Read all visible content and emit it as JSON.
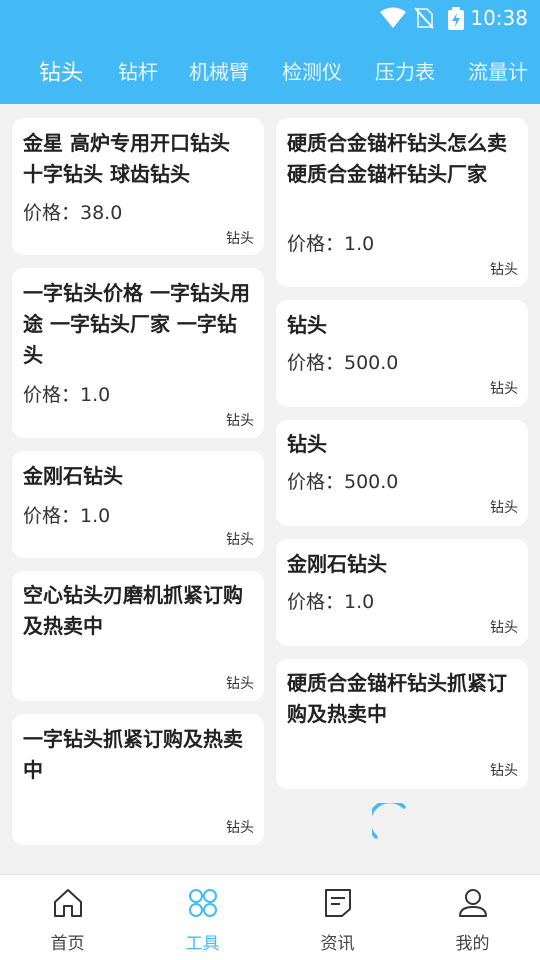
{
  "status_bar": {
    "time": "10:38",
    "icons": [
      "wifi-icon",
      "no-sim-icon",
      "battery-charging-icon"
    ]
  },
  "tabs": [
    {
      "label": "钻头",
      "active": true
    },
    {
      "label": "钻杆",
      "active": false
    },
    {
      "label": "机械臂",
      "active": false
    },
    {
      "label": "检测仪",
      "active": false
    },
    {
      "label": "压力表",
      "active": false
    },
    {
      "label": "流量计",
      "active": false
    }
  ],
  "left_column": [
    {
      "title": "金星 高炉专用开口钻头 十字钻头  球齿钻头",
      "price": "价格：38.0",
      "category": "钻头"
    },
    {
      "title": " 一字钻头价格 一字钻头用途 一字钻头厂家 一字钻头",
      "price": "价格：1.0",
      "category": "钻头"
    },
    {
      "title": "金刚石钻头",
      "price": "价格：1.0",
      "category": "钻头"
    },
    {
      "title": "空心钻头刃磨机抓紧订购及热卖中",
      "price": "",
      "category": "钻头"
    },
    {
      "title": "一字钻头抓紧订购及热卖中",
      "price": "",
      "category": "钻头"
    }
  ],
  "right_column": [
    {
      "title": " 硬质合金锚杆钻头怎么卖  硬质合金锚杆钻头厂家",
      "price": "价格：1.0",
      "category": "钻头"
    },
    {
      "title": "钻头",
      "price": "价格：500.0",
      "category": "钻头"
    },
    {
      "title": "钻头",
      "price": "价格：500.0",
      "category": "钻头"
    },
    {
      "title": "金刚石钻头",
      "price": "价格：1.0",
      "category": "钻头"
    },
    {
      "title": "硬质合金锚杆钻头抓紧订购及热卖中",
      "price": "",
      "category": "钻头"
    }
  ],
  "bottom_nav": [
    {
      "label": "首页",
      "icon": "home-icon",
      "active": false
    },
    {
      "label": "工具",
      "icon": "tools-grid-icon",
      "active": true
    },
    {
      "label": "资讯",
      "icon": "news-icon",
      "active": false
    },
    {
      "label": "我的",
      "icon": "profile-icon",
      "active": false
    }
  ],
  "colors": {
    "accent": "#43b9f5",
    "background": "#f1f1f1",
    "card": "#ffffff"
  }
}
